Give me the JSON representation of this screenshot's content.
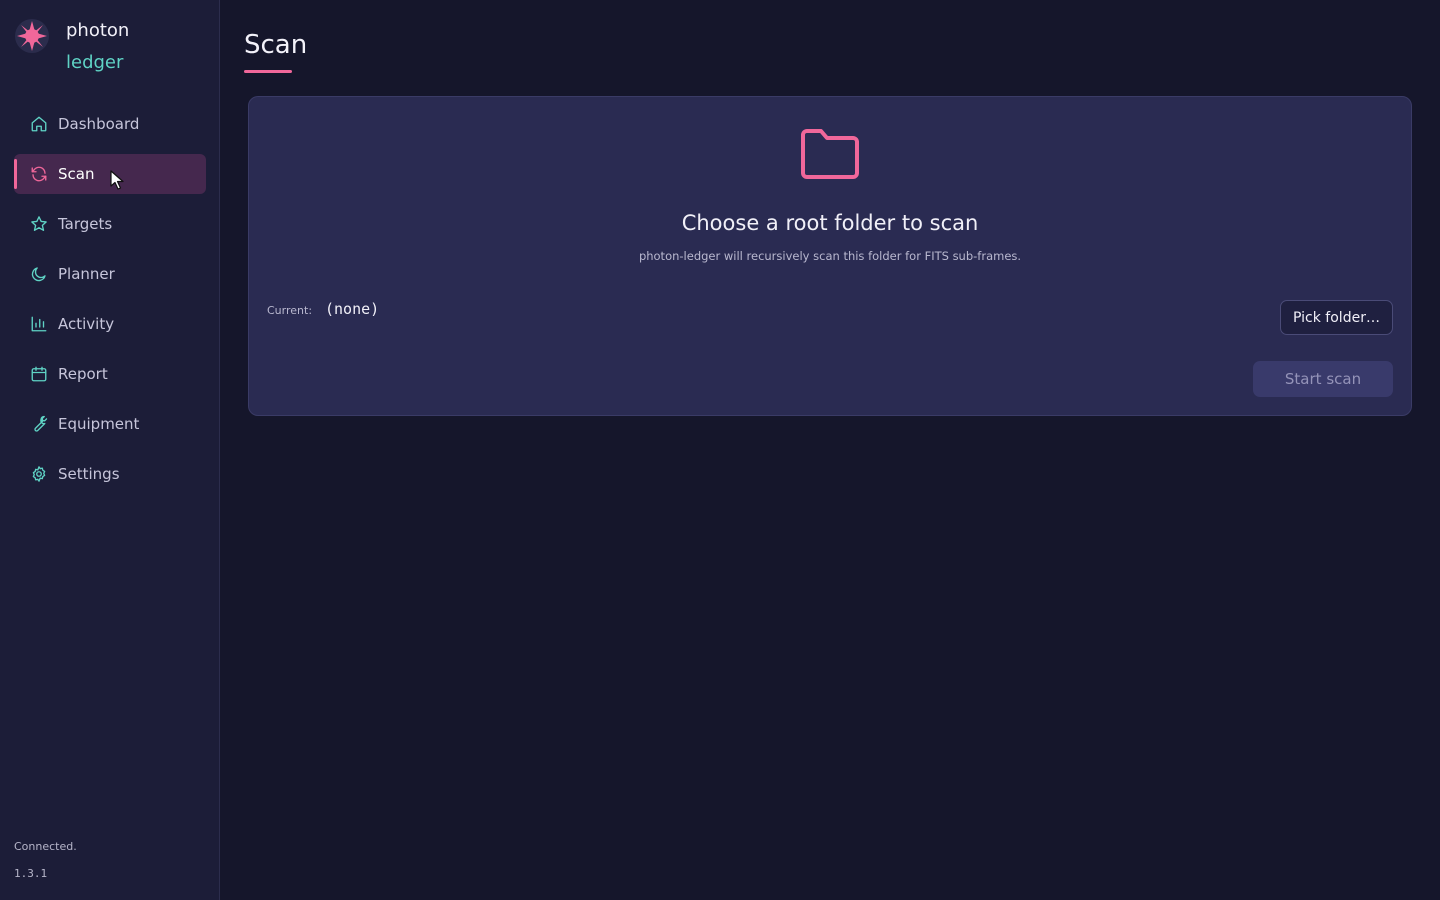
{
  "app": {
    "brand_line1": "photon",
    "brand_line2": "ledger",
    "logo_icon": "star-logo-icon",
    "accent_color": "#f0679a",
    "secondary_color": "#5fd3c5"
  },
  "sidebar": {
    "items": [
      {
        "label": "Dashboard",
        "icon": "home-icon",
        "active": false
      },
      {
        "label": "Scan",
        "icon": "refresh-icon",
        "active": true
      },
      {
        "label": "Targets",
        "icon": "star-icon",
        "active": false
      },
      {
        "label": "Planner",
        "icon": "moon-icon",
        "active": false
      },
      {
        "label": "Activity",
        "icon": "bar-chart-icon",
        "active": false
      },
      {
        "label": "Report",
        "icon": "calendar-icon",
        "active": false
      },
      {
        "label": "Equipment",
        "icon": "wrench-icon",
        "active": false
      },
      {
        "label": "Settings",
        "icon": "gear-icon",
        "active": false
      }
    ],
    "status": "Connected.",
    "version": "1.3.1"
  },
  "main": {
    "title": "Scan",
    "card": {
      "icon": "folder-icon",
      "heading": "Choose a root folder to scan",
      "subtext": "photon-ledger will recursively scan this folder for FITS sub-frames.",
      "current_label": "Current:",
      "current_value": "(none)",
      "pick_button": "Pick folder…",
      "start_button": "Start scan",
      "start_enabled": false
    }
  }
}
